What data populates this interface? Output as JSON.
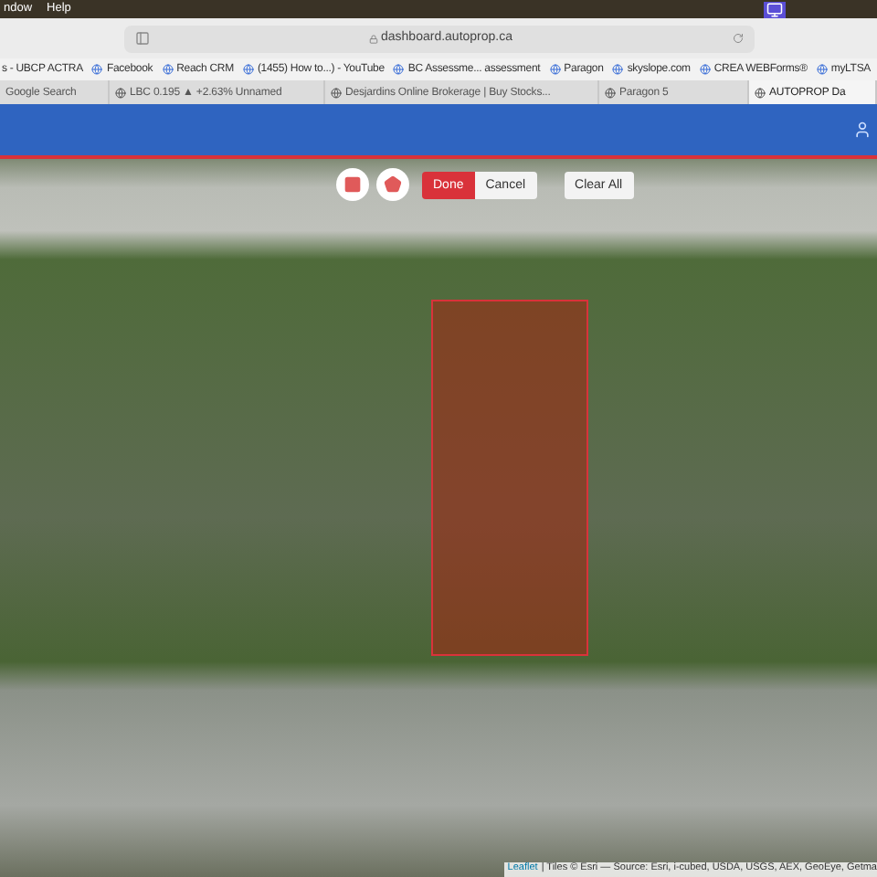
{
  "menu_bar": {
    "items": [
      "ndow",
      "Help"
    ]
  },
  "address_bar": {
    "url": "dashboard.autoprop.ca"
  },
  "bookmarks": [
    "s - UBCP ACTRA",
    "Facebook",
    "Reach CRM",
    "(1455) How to...) - YouTube",
    "BC Assessme... assessment",
    "Paragon",
    "skyslope.com",
    "CREA WEBForms®",
    "myLTSA"
  ],
  "tabs": [
    {
      "label": "Google Search",
      "selected": false
    },
    {
      "label": "LBC 0.195 ▲ +2.63% Unnamed",
      "selected": false
    },
    {
      "label": "Desjardins Online Brokerage | Buy Stocks...",
      "selected": false
    },
    {
      "label": "Paragon 5",
      "selected": false
    },
    {
      "label": "AUTOPROP Da",
      "selected": true
    }
  ],
  "map_toolbar": {
    "buttons": [
      {
        "label": "Done",
        "kind": "primary"
      },
      {
        "label": "Cancel",
        "kind": "secondary"
      },
      {
        "label": "Clear All",
        "kind": "standalone"
      }
    ]
  },
  "attribution": {
    "link": "Leaflet",
    "text": "| Tiles © Esri — Source: Esri, i-cubed, USDA, USGS, AEX, GeoEye, Getma"
  }
}
